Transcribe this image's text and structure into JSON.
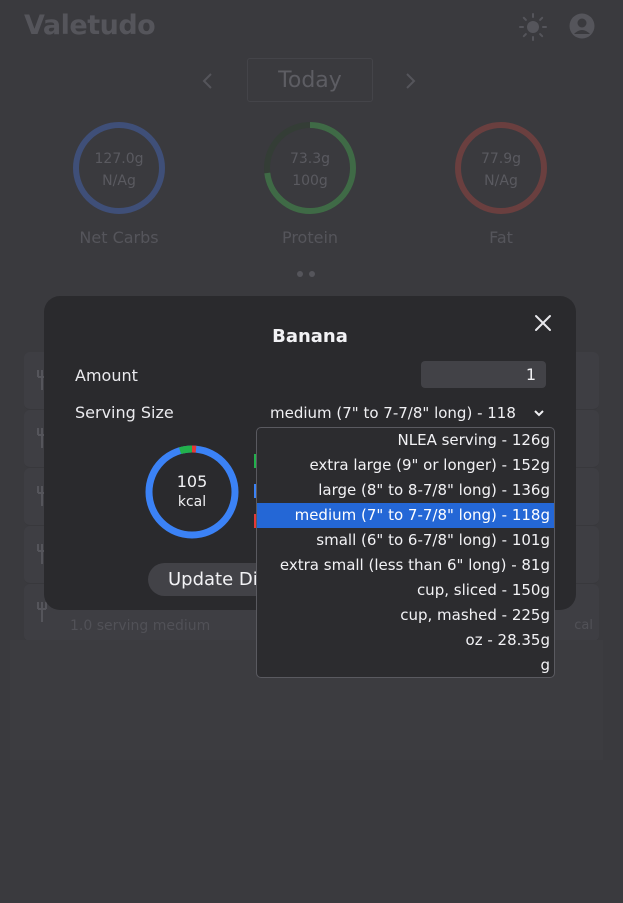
{
  "app": {
    "title": "Valetudo"
  },
  "date_nav": {
    "label": "Today"
  },
  "macros": [
    {
      "name": "Net Carbs",
      "value": "127.0g",
      "goal": "N/Ag",
      "color": "#3f4f78"
    },
    {
      "name": "Protein",
      "value": "73.3g",
      "goal": "100g",
      "color": "#3f6a46",
      "progress": 0.73
    },
    {
      "name": "Fat",
      "value": "77.9g",
      "goal": "N/Ag",
      "color": "#6a3f3f"
    }
  ],
  "log": {
    "last_item_sub": "1.0 serving medium",
    "last_item_kcal_partial": "cal"
  },
  "modal": {
    "title": "Banana",
    "amount_label": "Amount",
    "amount_value": "1",
    "serving_label": "Serving Size",
    "serving_value": "medium (7\" to 7-7/8\" long) - 118g",
    "kcal_value": "105",
    "kcal_unit": "kcal",
    "update_button": "Update Diary",
    "colors": {
      "ring": "#3b82f6",
      "carbs": "#3b82f6",
      "protein": "#22b14c",
      "fat": "#e53935"
    }
  },
  "dropdown": {
    "options": [
      "NLEA serving - 126g",
      "extra large (9\" or longer) - 152g",
      "large (8\" to 8-7/8\" long) - 136g",
      "medium (7\" to 7-7/8\" long) - 118g",
      "small (6\" to 6-7/8\" long) - 101g",
      "extra small (less than 6\" long) - 81g",
      "cup, sliced - 150g",
      "cup, mashed - 225g",
      "oz - 28.35g",
      "g"
    ],
    "selected_index": 3
  }
}
